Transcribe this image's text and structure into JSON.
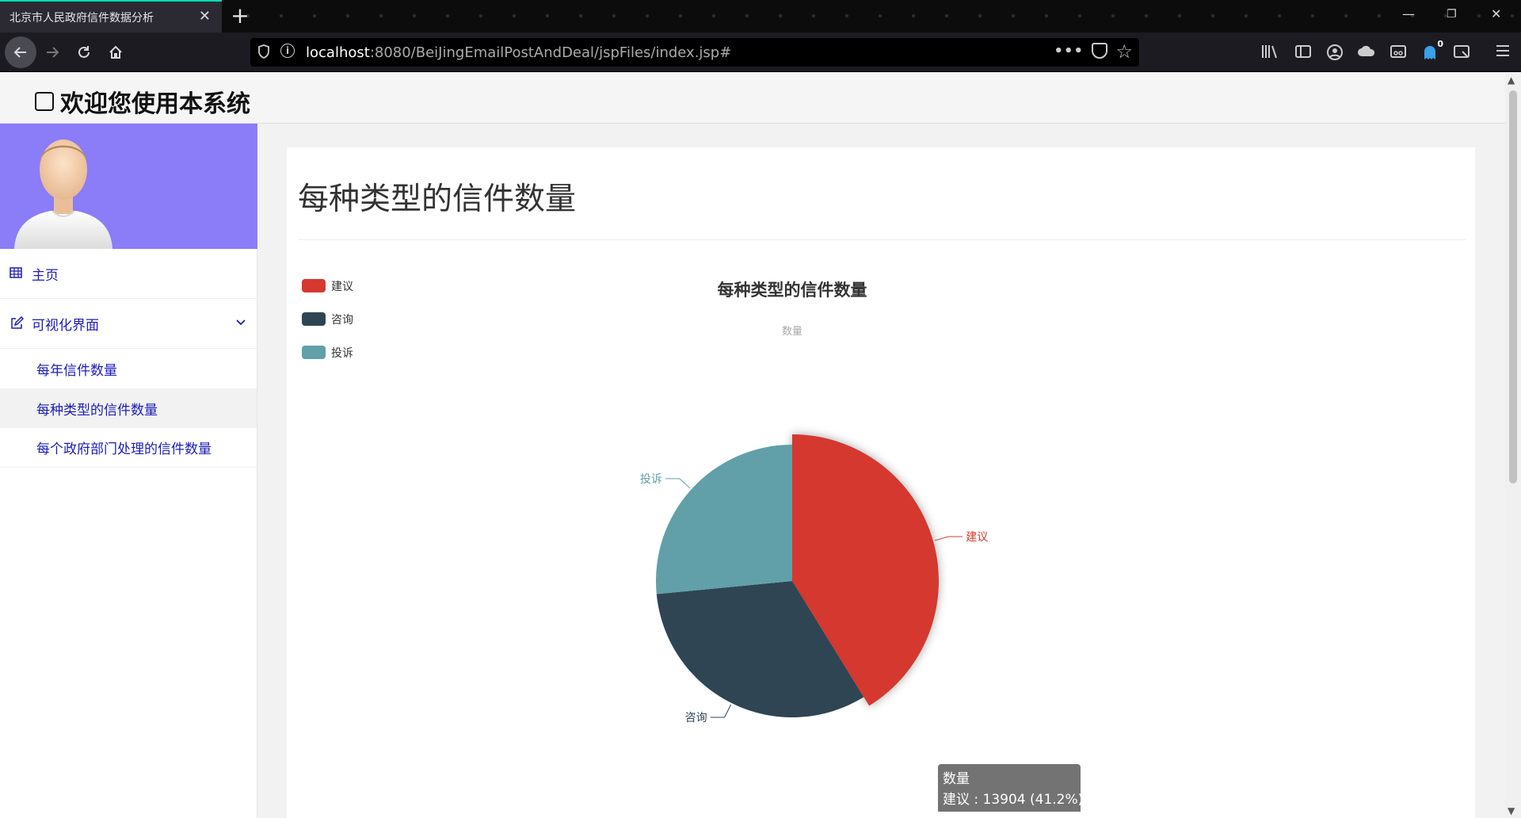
{
  "browser": {
    "tab_title": "北京市人民政府信件数据分析",
    "url_host": "localhost",
    "url_rest": ":8080/BeiJingEmailPostAndDeal/jspFiles/index.jsp#",
    "badge_count": "0"
  },
  "header": {
    "title": "欢迎您使用本系统"
  },
  "sidebar": {
    "items": [
      {
        "label": "主页",
        "icon": "table-icon"
      },
      {
        "label": "可视化界面",
        "icon": "edit-icon"
      }
    ],
    "submenu": [
      {
        "label": "每年信件数量"
      },
      {
        "label": "每种类型的信件数量"
      },
      {
        "label": "每个政府部门处理的信件数量"
      }
    ]
  },
  "main": {
    "title": "每种类型的信件数量"
  },
  "chart_data": {
    "type": "pie",
    "title": "每种类型的信件数量",
    "subtitle": "数量",
    "legend_position": "top-left",
    "series": [
      {
        "name": "建议",
        "color": "#d5392f"
      },
      {
        "name": "咨询",
        "color": "#2f4554"
      },
      {
        "name": "投诉",
        "color": "#61a0a8"
      }
    ],
    "values": [
      13904,
      10890,
      8954
    ],
    "tooltip": {
      "line1": "数量",
      "line2": "建议 : 13904 (41.2%)"
    },
    "highlighted": "建议"
  }
}
